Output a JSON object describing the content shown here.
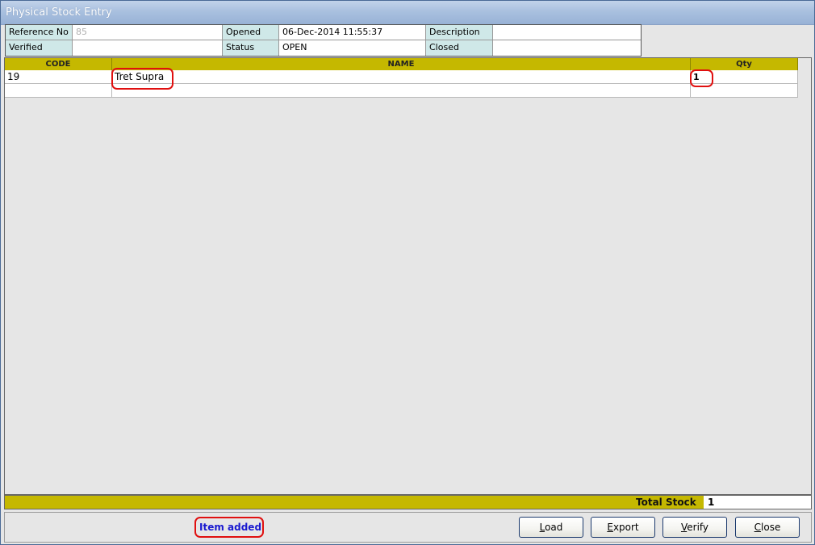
{
  "window": {
    "title": "Physical Stock Entry"
  },
  "info": {
    "reference_no_label": "Reference No",
    "reference_no_value": "85",
    "opened_label": "Opened",
    "opened_value": "06-Dec-2014 11:55:37",
    "description_label": "Description",
    "description_value": "",
    "verified_label": "Verified",
    "verified_value": "",
    "status_label": "Status",
    "status_value": "OPEN",
    "closed_label": "Closed",
    "closed_value": ""
  },
  "grid": {
    "columns": [
      "CODE",
      "NAME",
      "Qty"
    ],
    "rows": [
      {
        "code": "19",
        "name": "Tret Supra",
        "qty": "1"
      },
      {
        "code": "",
        "name": "",
        "qty": ""
      }
    ]
  },
  "totals": {
    "label": "Total Stock",
    "value": "1"
  },
  "status_message": "Item added",
  "buttons": {
    "load": {
      "key": "L",
      "rest": "oad"
    },
    "export": {
      "key": "E",
      "rest": "xport"
    },
    "verify": {
      "key": "V",
      "rest": "erify"
    },
    "close": {
      "key": "C",
      "rest": "lose"
    }
  },
  "colors": {
    "header": "#c5b800",
    "label_cell": "#cfe8e8",
    "highlight": "#e01010",
    "status_text": "#1a1ad0"
  }
}
